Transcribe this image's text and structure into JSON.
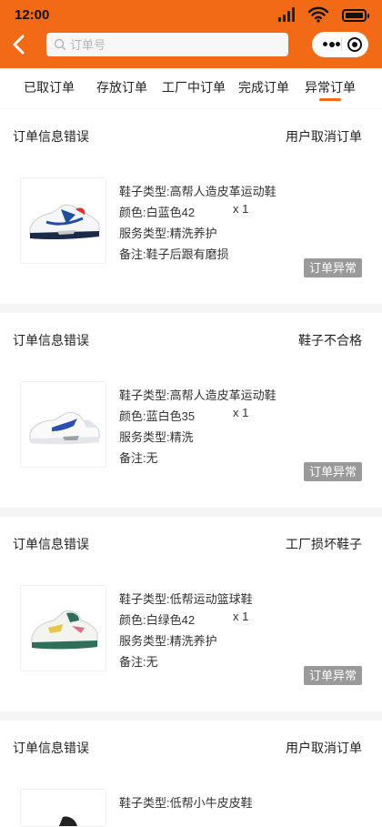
{
  "status_bar": {
    "time": "12:00"
  },
  "header": {
    "search_placeholder": "订单号"
  },
  "tabs": [
    {
      "label": "已取订单",
      "active": false
    },
    {
      "label": "存放订单",
      "active": false
    },
    {
      "label": "工厂中订单",
      "active": false
    },
    {
      "label": "完成订单",
      "active": false
    },
    {
      "label": "异常订单",
      "active": true
    }
  ],
  "colors": {
    "brand": "#f26a16",
    "status_badge": "#9a9a9a"
  },
  "orders": [
    {
      "title": "订单信息错误",
      "reason": "用户取消订单",
      "shoe_type": "鞋子类型:高帮人造皮革运动鞋",
      "color": "颜色:白蓝色42",
      "qty": "x 1",
      "service": "服务类型:精洗养护",
      "note": "备注:鞋子后跟有磨损",
      "status": "订单异常",
      "image": "white-blue-high-top-sneaker"
    },
    {
      "title": "订单信息错误",
      "reason": "鞋子不合格",
      "shoe_type": "鞋子类型:高帮人造皮革运动鞋",
      "color": "颜色:蓝白色35",
      "qty": "x 1",
      "service": "服务类型:精洗",
      "note": "备注:无",
      "status": "订单异常",
      "image": "white-blue-sneaker"
    },
    {
      "title": "订单信息错误",
      "reason": "工厂损坏鞋子",
      "shoe_type": "鞋子类型:低帮运动篮球鞋",
      "color": "颜色:白绿色42",
      "qty": "x 1",
      "service": "服务类型:精洗养护",
      "note": "备注:无",
      "status": "订单异常",
      "image": "white-green-basketball-shoe"
    },
    {
      "title": "订单信息错误",
      "reason": "用户取消订单",
      "shoe_type": "鞋子类型:低帮小牛皮皮鞋",
      "color": "",
      "qty": "",
      "service": "",
      "note": "",
      "status": "",
      "image": "calfskin-shoe"
    }
  ]
}
